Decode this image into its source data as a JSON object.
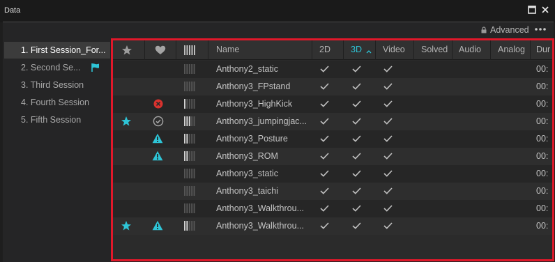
{
  "window": {
    "title": "Data"
  },
  "toolbar": {
    "advanced_label": "Advanced"
  },
  "sessions": [
    {
      "label": "1. First Session_For...",
      "active": true,
      "flag": false
    },
    {
      "label": "2. Second Se...",
      "active": false,
      "flag": true
    },
    {
      "label": "3. Third Session",
      "active": false,
      "flag": false
    },
    {
      "label": "4. Fourth Session",
      "active": false,
      "flag": false
    },
    {
      "label": "5. Fifth Session",
      "active": false,
      "flag": false
    }
  ],
  "columns": {
    "name": "Name",
    "c2d": "2D",
    "c3d": "3D",
    "video": "Video",
    "solved": "Solved",
    "audio": "Audio",
    "analog": "Analog",
    "duration": "Dur"
  },
  "sorted_column": "3D",
  "accent_color": "#2ec4d6",
  "error_color": "#d9322e",
  "rows": [
    {
      "name": "Anthony2_static",
      "star": false,
      "status": "none",
      "signal": "empty",
      "d2": true,
      "d3": true,
      "video": true,
      "dur": "00:"
    },
    {
      "name": "Anthony3_FPstand",
      "star": false,
      "status": "none",
      "signal": "empty",
      "d2": true,
      "d3": true,
      "video": true,
      "dur": "00:"
    },
    {
      "name": "Anthony3_HighKick",
      "star": false,
      "status": "error",
      "signal": "one",
      "d2": true,
      "d3": true,
      "video": true,
      "dur": "00:"
    },
    {
      "name": "Anthony3_jumpingjac...",
      "star": true,
      "status": "check",
      "signal": "three",
      "d2": true,
      "d3": true,
      "video": true,
      "dur": "00:"
    },
    {
      "name": "Anthony3_Posture",
      "star": false,
      "status": "warning",
      "signal": "two",
      "d2": true,
      "d3": true,
      "video": true,
      "dur": "00:"
    },
    {
      "name": "Anthony3_ROM",
      "star": false,
      "status": "warning",
      "signal": "two",
      "d2": true,
      "d3": true,
      "video": true,
      "dur": "00:"
    },
    {
      "name": "Anthony3_static",
      "star": false,
      "status": "none",
      "signal": "empty",
      "d2": true,
      "d3": true,
      "video": true,
      "dur": "00:"
    },
    {
      "name": "Anthony3_taichi",
      "star": false,
      "status": "none",
      "signal": "empty",
      "d2": true,
      "d3": true,
      "video": true,
      "dur": "00:"
    },
    {
      "name": "Anthony3_Walkthrou...",
      "star": false,
      "status": "none",
      "signal": "empty",
      "d2": true,
      "d3": true,
      "video": true,
      "dur": "00:"
    },
    {
      "name": "Anthony3_Walkthrou...",
      "star": true,
      "status": "warning",
      "signal": "two",
      "d2": true,
      "d3": true,
      "video": true,
      "dur": "00:"
    }
  ]
}
